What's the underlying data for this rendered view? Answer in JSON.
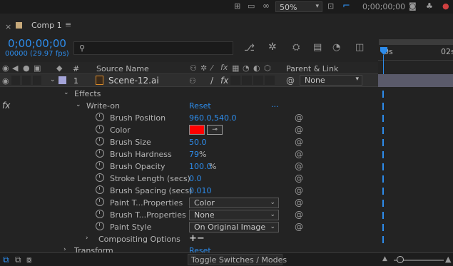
{
  "viewer": {
    "zoom": "50%",
    "timecode": "0;00;00;00"
  },
  "comp_tab": {
    "label": "Comp 1"
  },
  "timecode": {
    "main": "0;00;00;00",
    "sub": "00000 (29.97 fps)"
  },
  "search": {
    "placeholder": ""
  },
  "columns": {
    "hash": "#",
    "source_name": "Source Name",
    "parent_link": "Parent & Link"
  },
  "layer": {
    "number": "1",
    "name": "Scene-12.ai",
    "parent": "None"
  },
  "ruler": {
    "start": "0s",
    "end": "02s"
  },
  "labels": {
    "effects": "Effects",
    "fx": "fx",
    "write_on": "Write-on",
    "reset": "Reset",
    "compositing": "Compositing Options",
    "transform": "Transform",
    "transform_reset": "Reset",
    "toggle": "Toggle Switches / Modes",
    "plusminus": "+−",
    "dots": "..."
  },
  "properties": [
    {
      "name": "Brush Position",
      "value": "960.0,540.0",
      "unit": ""
    },
    {
      "name": "Color",
      "value": "",
      "unit": ""
    },
    {
      "name": "Brush Size",
      "value": "50.0",
      "unit": ""
    },
    {
      "name": "Brush Hardness",
      "value": "79",
      "unit": "%"
    },
    {
      "name": "Brush Opacity",
      "value": "100.0",
      "unit": "%"
    },
    {
      "name": "Stroke Length (secs)",
      "value": "0.0",
      "unit": ""
    },
    {
      "name": "Brush Spacing (secs)",
      "value": "0.010",
      "unit": ""
    },
    {
      "name": "Paint T...Properties",
      "value": "Color",
      "unit": ""
    },
    {
      "name": "Brush T...Properties",
      "value": "None",
      "unit": ""
    },
    {
      "name": "Paint Style",
      "value": "On Original Image",
      "unit": ""
    }
  ],
  "colors": {
    "brush_color": "#ff0000",
    "accent": "#2d8ceb",
    "layer_label": "#a4a4d8"
  }
}
